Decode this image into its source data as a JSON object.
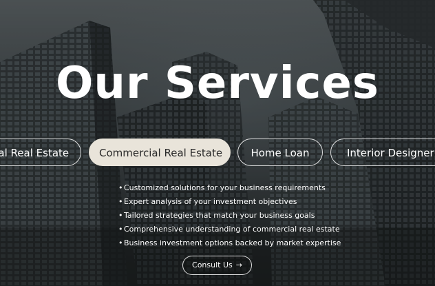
{
  "header": {
    "title": "Our Services"
  },
  "tabs": [
    {
      "label": "cial Real Estate",
      "active": false
    },
    {
      "label": "Commercial Real Estate",
      "active": true
    },
    {
      "label": "Home Loan",
      "active": false
    },
    {
      "label": "Interior Designer",
      "active": false
    }
  ],
  "features": [
    "Customized solutions for your business requirements",
    "Expert analysis of your investment objectives",
    "Tailored strategies that match your business goals",
    "Comprehensive understanding of commercial real estate",
    "Business investment options backed by market expertise"
  ],
  "bullet": "•",
  "cta": {
    "label": "Consult Us",
    "icon": "arrow-right-icon",
    "glyph": "→"
  },
  "colors": {
    "active_tab_bg": "#e9e4da",
    "text": "#ffffff",
    "dark_text": "#2a2a2a"
  }
}
